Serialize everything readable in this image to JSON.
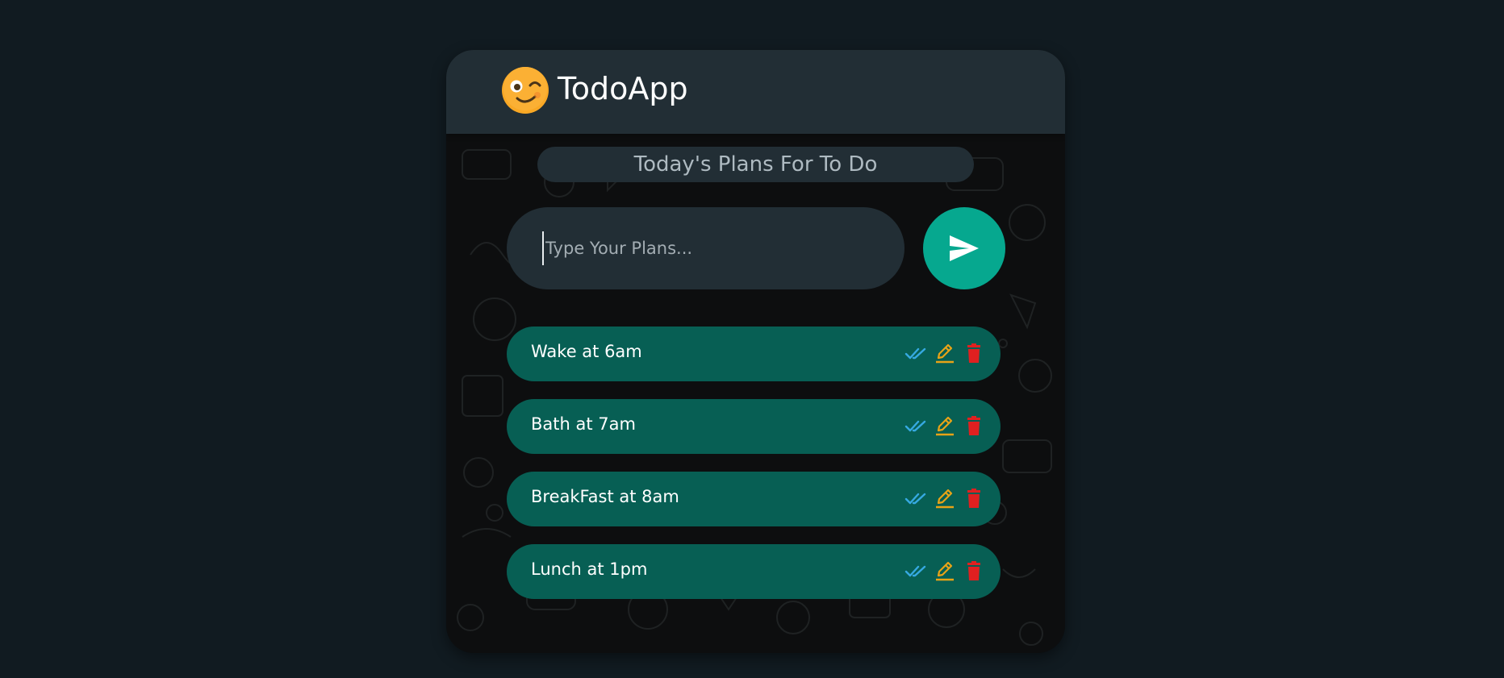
{
  "app": {
    "title": "TodoApp",
    "logo_icon": "winking-face-emoji",
    "subtitle": "Today's Plans For To Do"
  },
  "input": {
    "value": "",
    "placeholder": "Type Your Plans..."
  },
  "send_button": {
    "icon": "send-arrow-icon"
  },
  "todos": [
    {
      "text": "Wake at 6am"
    },
    {
      "text": "Bath at 7am"
    },
    {
      "text": "BreakFast at 8am"
    },
    {
      "text": "Lunch at 1pm"
    }
  ],
  "item_actions": {
    "done_icon": "double-check-icon",
    "edit_icon": "pencil-icon",
    "delete_icon": "trash-icon"
  },
  "colors": {
    "page_background": "#111b21",
    "header": "#222e35",
    "accent_send": "#06a88f",
    "item_background": "#075f54",
    "done_check": "#36a9e1",
    "edit_pencil": "#e8a317",
    "delete_trash": "#e02020"
  }
}
